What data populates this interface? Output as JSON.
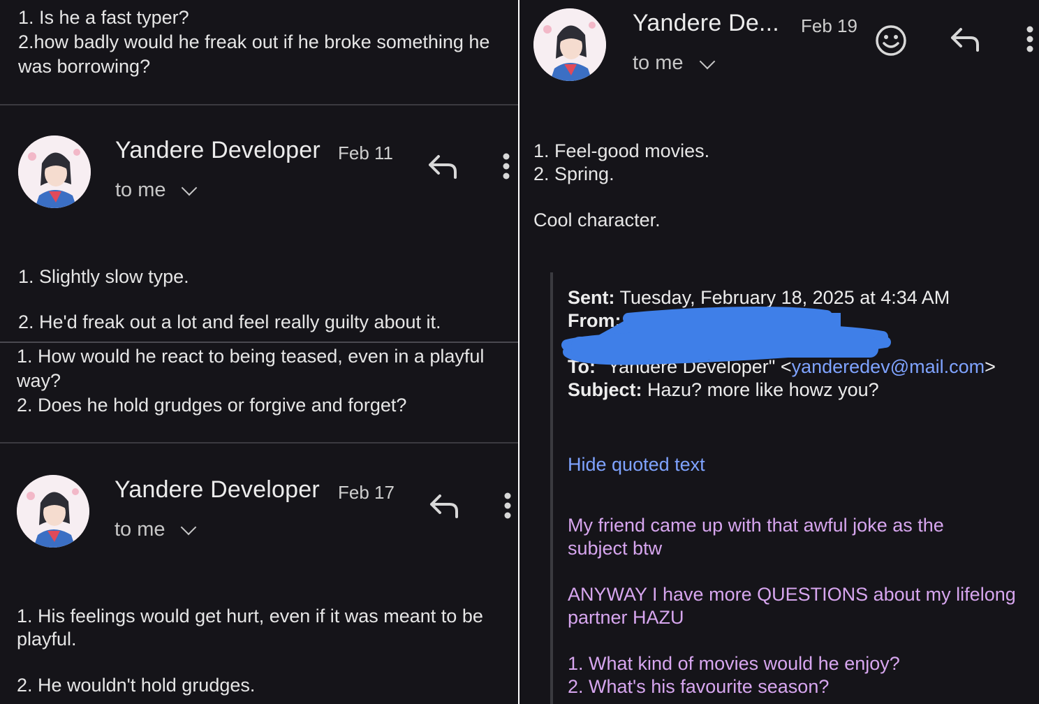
{
  "left": {
    "top_question": "1. Is he a fast typer?\n2.how badly would he freak out if he broke something he was borrowing?",
    "email1": {
      "sender": "Yandere Developer",
      "date": "Feb 11",
      "recipient": "to me",
      "answer1": "1. Slightly slow type.",
      "answer2": "2. He'd freak out a lot and feel really guilty about it."
    },
    "question2": "1. How would he react to being teased, even in a playful way?\n2. Does he hold grudges or forgive and forget?",
    "email2": {
      "sender": "Yandere Developer",
      "date": "Feb 17",
      "recipient": "to me",
      "answer1": "1. His feelings would get hurt, even if it was meant to be playful.",
      "answer2": "2. He wouldn't hold grudges."
    }
  },
  "right": {
    "header": {
      "sender": "Yandere De...",
      "date": "Feb 19",
      "recipient": "to me"
    },
    "body": {
      "line1": "1. Feel-good movies.",
      "line2": "2. Spring.",
      "line3": "Cool character."
    },
    "quoted": {
      "sent_label": "Sent:",
      "sent_value": "Tuesday, February 18, 2025 at 4:34 AM",
      "from_label": "From:",
      "to_label": "To:",
      "to_name": "\"Yandere Developer\" <",
      "to_email": "yanderedev@mail.com",
      "to_close": ">",
      "subject_label": "Subject:",
      "subject_value": "Hazu? more like howz you?",
      "hide_quoted": "Hide quoted text",
      "para1": "My friend came up with that awful joke as the subject btw",
      "para2": "ANYWAY I have more QUESTIONS about my lifelong partner HAZU",
      "q1": "1. What kind of movies would he enjoy?",
      "q2": "2. What's his favourite season?"
    }
  },
  "icons": [
    "avatar",
    "reply-icon",
    "more-vert-icon",
    "emoji-icon",
    "chevron-down-icon"
  ],
  "colors": {
    "background": "#151419",
    "link": "#7fa3ff",
    "quoted_pink": "#d7a6ef",
    "redaction": "#3f7fe8"
  }
}
